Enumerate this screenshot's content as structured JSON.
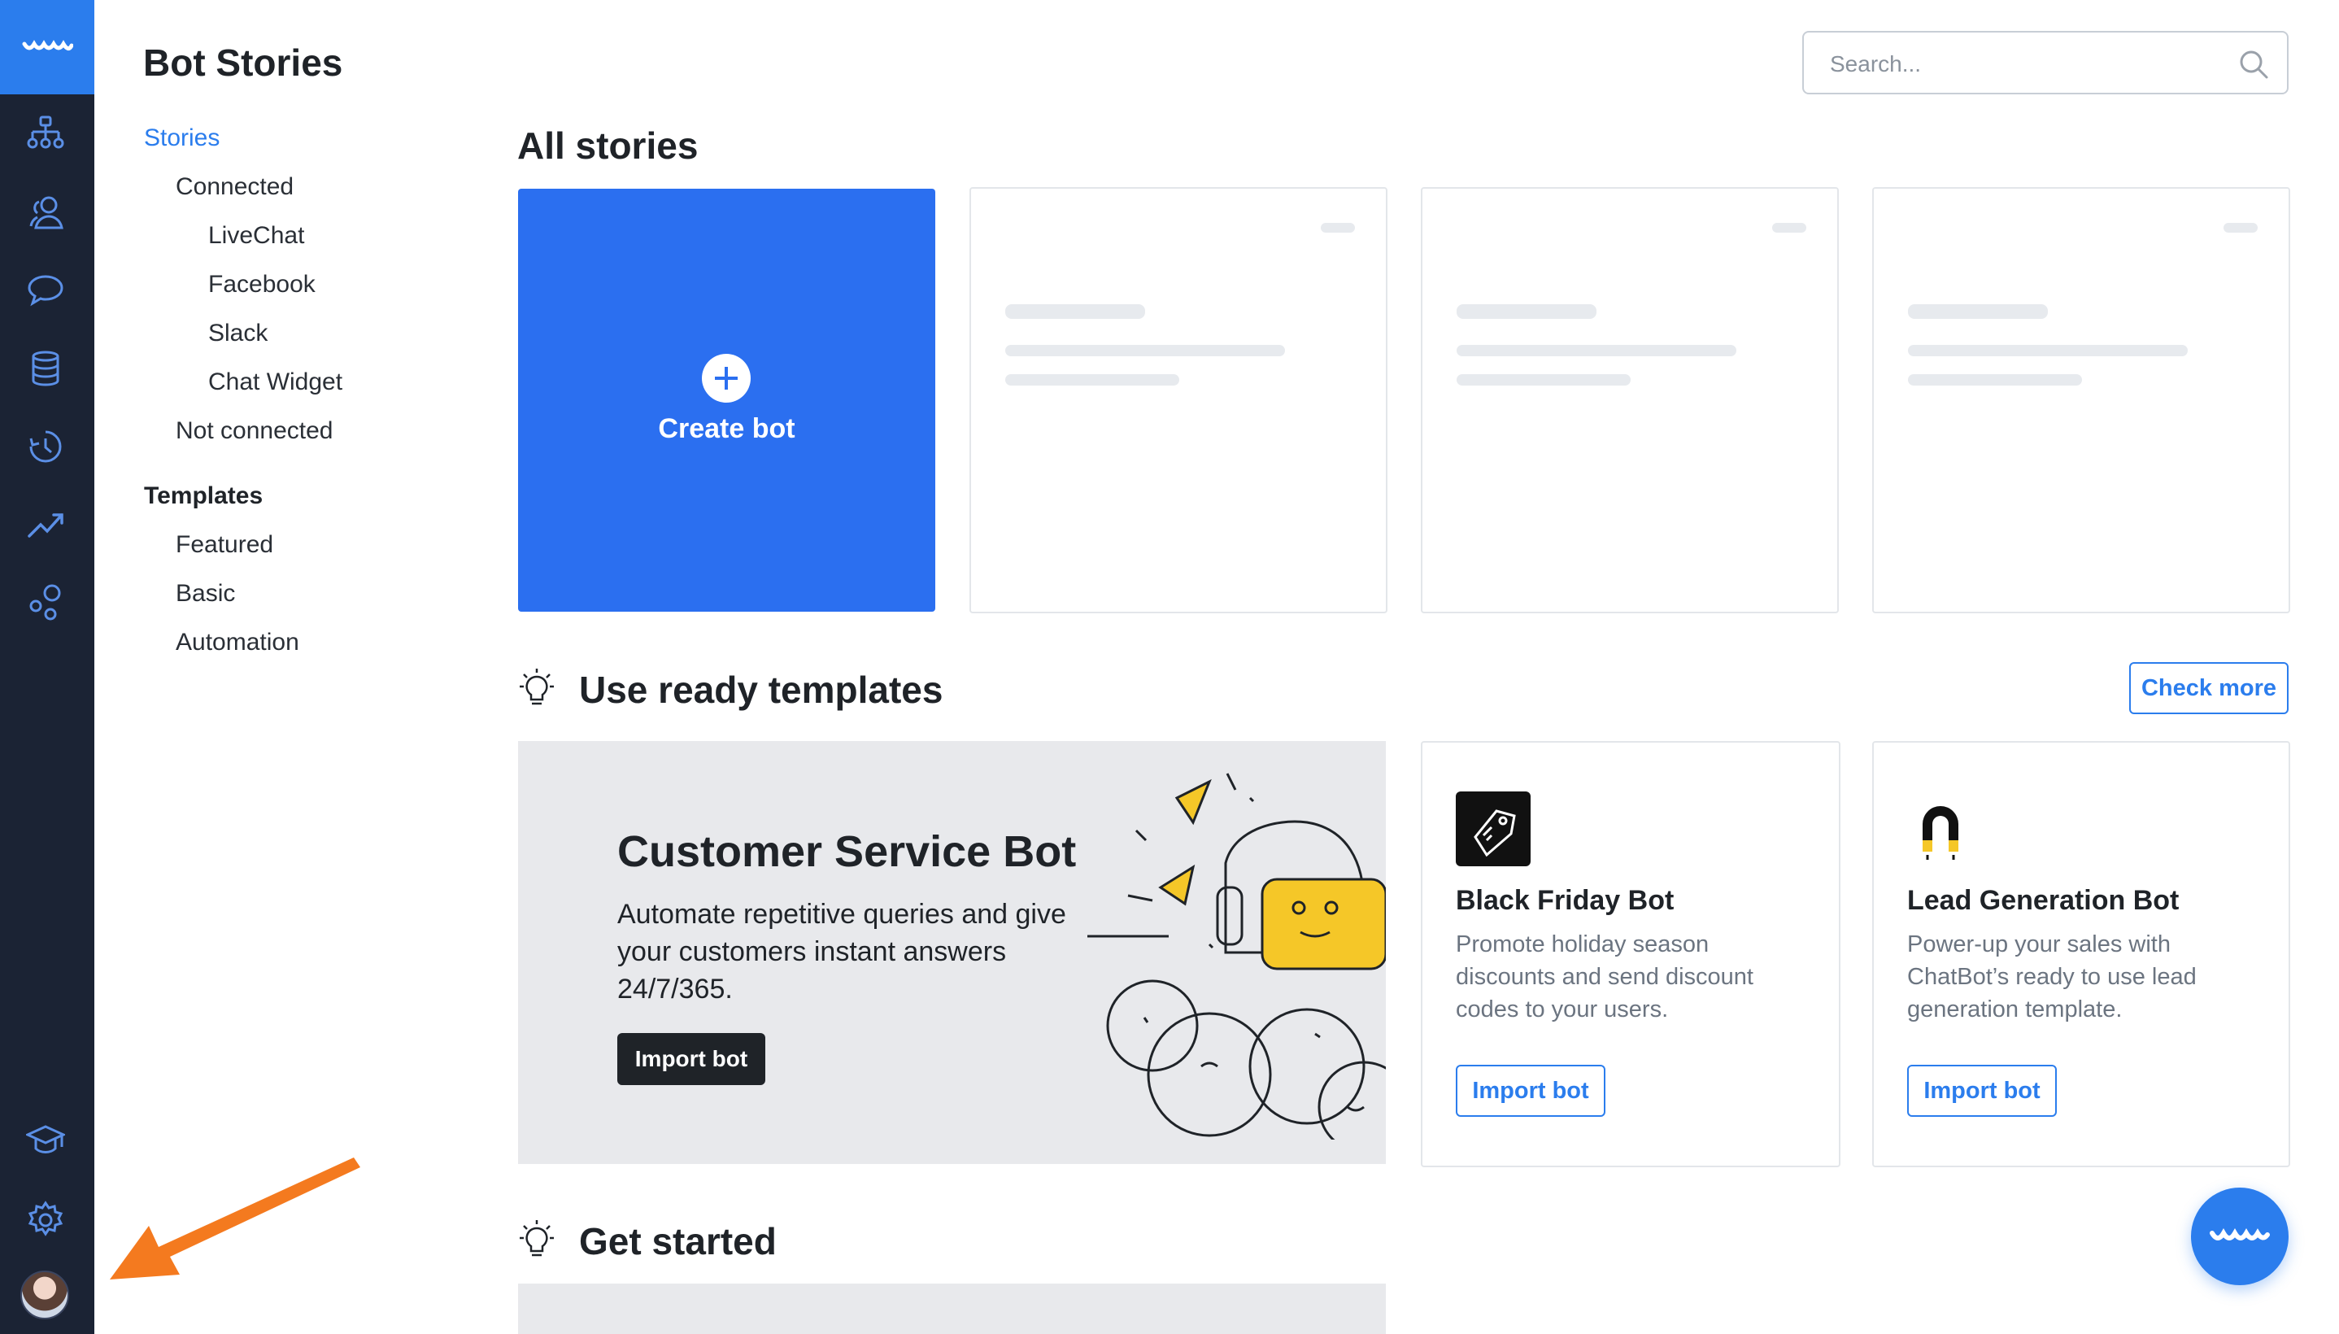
{
  "sidebar": {
    "title": "Bot Stories",
    "stories": "Stories",
    "connected": "Connected",
    "livechat": "LiveChat",
    "facebook": "Facebook",
    "slack": "Slack",
    "chat_widget": "Chat Widget",
    "not_connected": "Not connected",
    "templates": "Templates",
    "featured": "Featured",
    "basic": "Basic",
    "automation": "Automation"
  },
  "search": {
    "placeholder": "Search..."
  },
  "main": {
    "all_stories": "All stories",
    "create_bot": "Create bot",
    "use_templates": "Use ready templates",
    "check_more": "Check more",
    "get_started": "Get started"
  },
  "banner": {
    "title": "Customer Service Bot",
    "description": "Automate repetitive queries and give your customers instant answers 24/7/365.",
    "button": "Import bot"
  },
  "templates": [
    {
      "title": "Black Friday Bot",
      "description": "Promote holiday season discounts and send discount codes to your users.",
      "button": "Import bot"
    },
    {
      "title": "Lead Generation Bot",
      "description": "Power-up your sales with ChatBot’s ready to use lead generation template.",
      "button": "Import bot"
    }
  ],
  "colors": {
    "accent": "#2b7ded",
    "rail": "#1b2334",
    "create_card": "#2b6ff0",
    "arrow": "#f47a1f"
  }
}
